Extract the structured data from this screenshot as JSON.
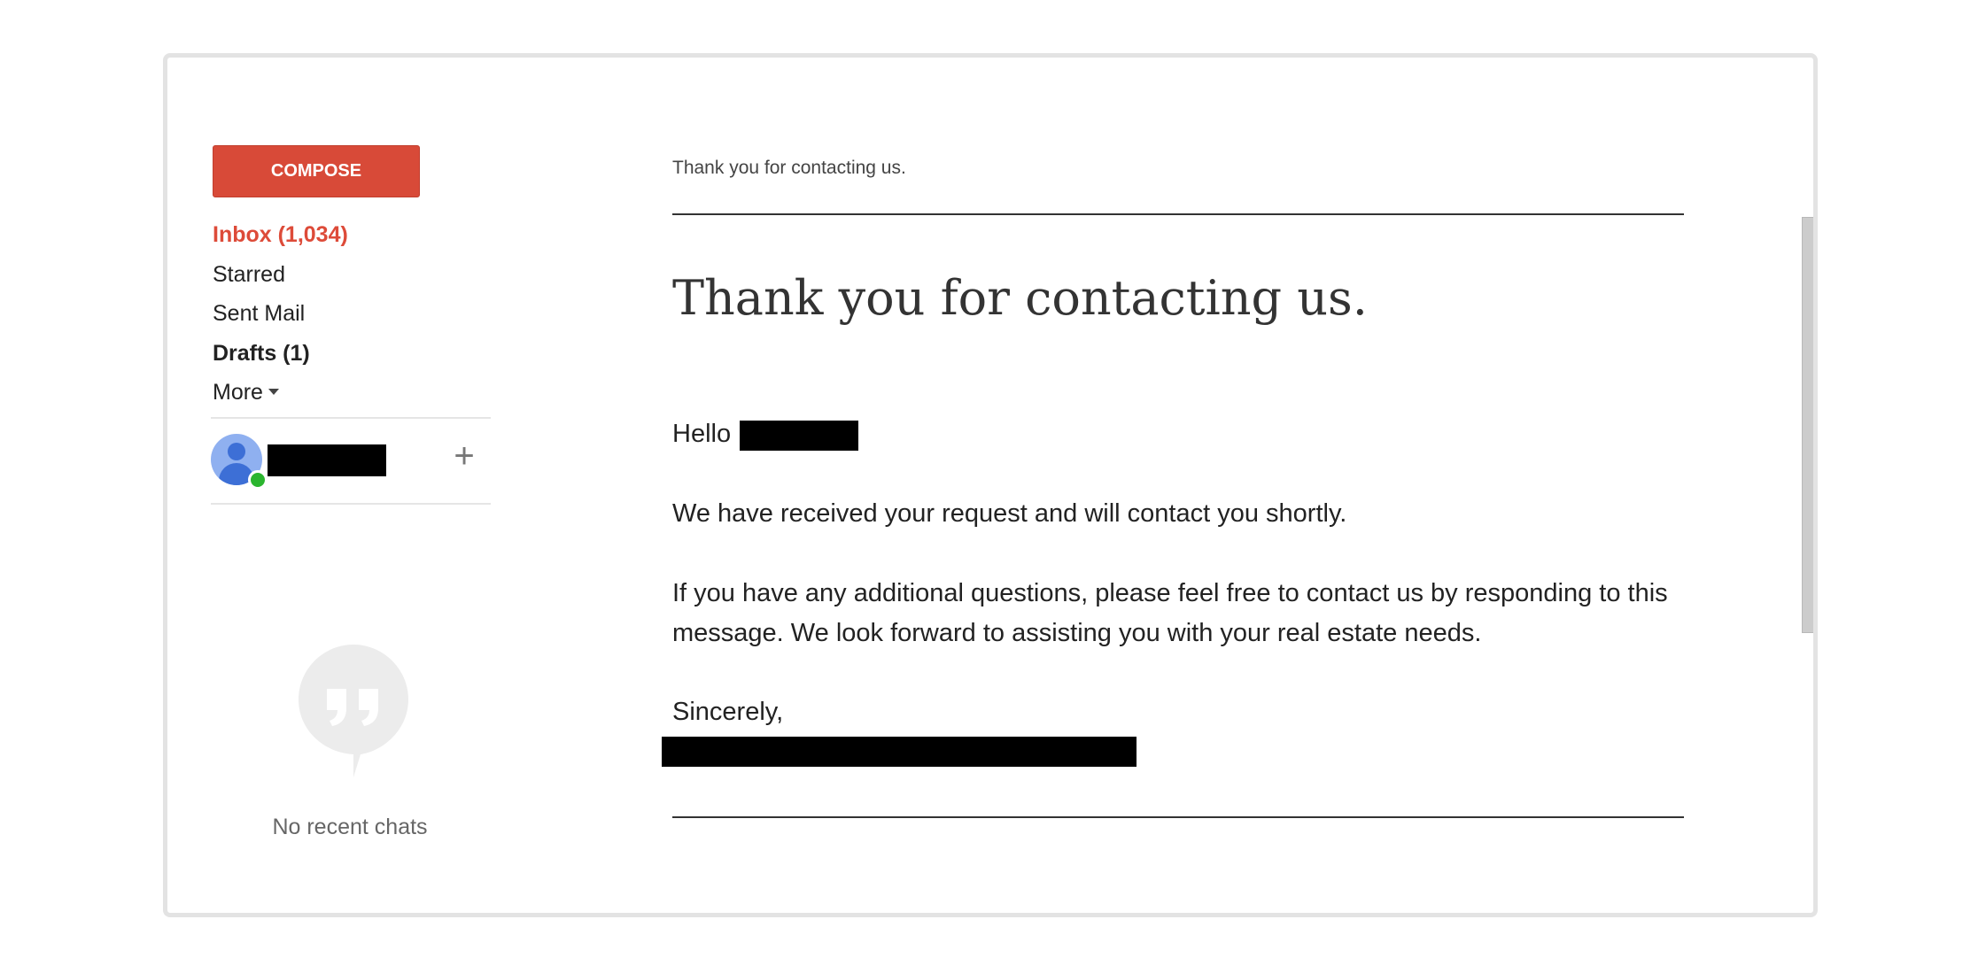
{
  "nav": {
    "compose_label": "COMPOSE",
    "items": [
      {
        "label": "Inbox (1,034)"
      },
      {
        "label": "Starred"
      },
      {
        "label": "Sent Mail"
      },
      {
        "label": "Drafts (1)"
      },
      {
        "label": "More"
      }
    ]
  },
  "hangouts": {
    "user_icon": "person-avatar-icon",
    "add_icon": "plus-icon",
    "add_label": "+",
    "chat_icon": "quote-bubble-icon",
    "empty_label": "No recent chats"
  },
  "message": {
    "subject": "Thank you for contacting us.",
    "heading": "Thank you for contacting us.",
    "greeting": "Hello",
    "paragraph1": "We have received your request and will contact you shortly.",
    "paragraph2": "If you have any additional questions, please feel free to contact us by responding to this message. We look forward to assisting you with your real estate needs.",
    "closing": "Sincerely,"
  },
  "colors": {
    "compose_red": "#d84a38",
    "inbox_red": "#dd4b39",
    "presence_green": "#2bb52f"
  }
}
